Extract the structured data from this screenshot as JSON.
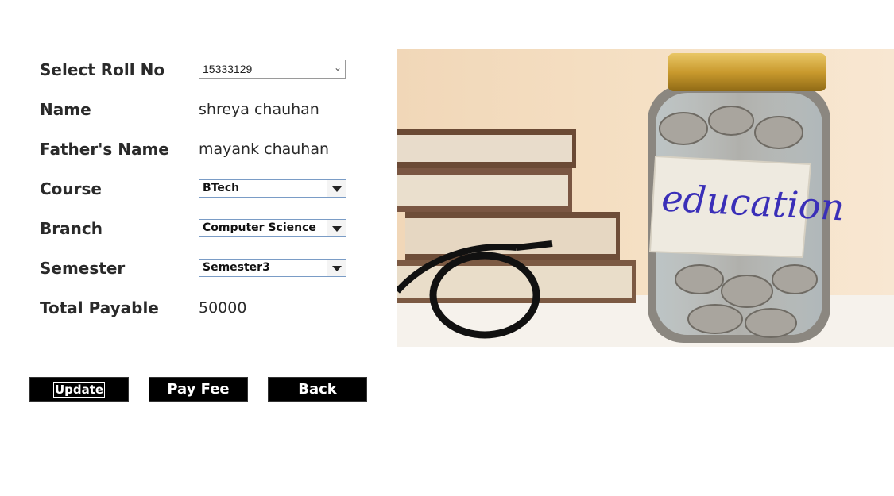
{
  "form": {
    "roll_label": "Select Roll No",
    "roll_value": "15333129",
    "name_label": "Name",
    "name_value": "shreya chauhan",
    "father_label": "Father's Name",
    "father_value": "mayank chauhan",
    "course_label": "Course",
    "course_value": "BTech",
    "branch_label": "Branch",
    "branch_value": "Computer Science",
    "semester_label": "Semester",
    "semester_value": "Semester3",
    "total_label": "Total Payable",
    "total_value": "50000"
  },
  "buttons": {
    "update": "Update",
    "pay_fee": "Pay Fee",
    "back": "Back"
  },
  "image": {
    "jar_label": "education"
  },
  "colors": {
    "button_bg": "#000000",
    "combo_border": "#7a9cc6",
    "jar_text": "#3a2fb8"
  }
}
